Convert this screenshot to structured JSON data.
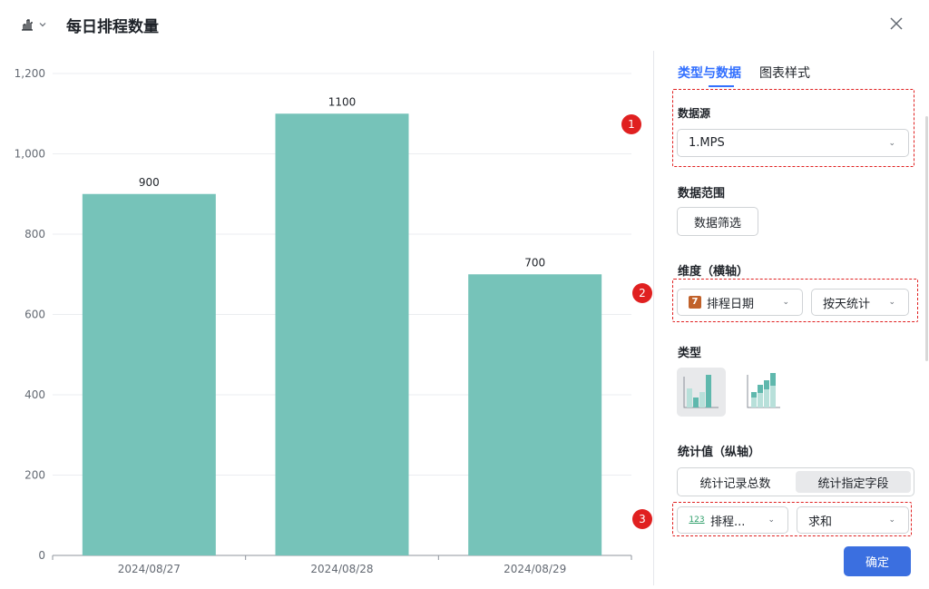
{
  "header": {
    "title": "每日排程数量"
  },
  "chart_data": {
    "type": "bar",
    "categories": [
      "2024/08/27",
      "2024/08/28",
      "2024/08/29"
    ],
    "values": [
      900,
      1100,
      700
    ],
    "data_labels": [
      "900",
      "1100",
      "700"
    ],
    "y_ticks": [
      "0",
      "200",
      "400",
      "600",
      "800",
      "1,000",
      "1,200"
    ],
    "y_tick_values": [
      0,
      200,
      400,
      600,
      800,
      1000,
      1200
    ],
    "ylim": [
      0,
      1200
    ],
    "grid": true,
    "bar_color": "#76c3b9"
  },
  "panel": {
    "tabs": [
      {
        "label": "类型与数据",
        "active": true
      },
      {
        "label": "图表样式",
        "active": false
      }
    ],
    "data_source": {
      "title": "数据源",
      "value": "1.MPS"
    },
    "data_range": {
      "title": "数据范围",
      "button": "数据筛选"
    },
    "dimension": {
      "title": "维度（横轴）",
      "field": "排程日期",
      "field_icon": "7",
      "granularity": "按天统计"
    },
    "chart_type": {
      "title": "类型"
    },
    "measure": {
      "title": "统计值（纵轴）",
      "options": [
        "统计记录总数",
        "统计指定字段"
      ],
      "active_option": 1,
      "field": "排程...",
      "field_icon": "123",
      "aggregation": "求和"
    },
    "confirm": "确定"
  },
  "annotations": [
    "1",
    "2",
    "3"
  ],
  "colors": {
    "accent": "#3370ff",
    "confirm": "#3b6fe0",
    "annotation": "#e02020",
    "bar": "#76c3b9"
  }
}
